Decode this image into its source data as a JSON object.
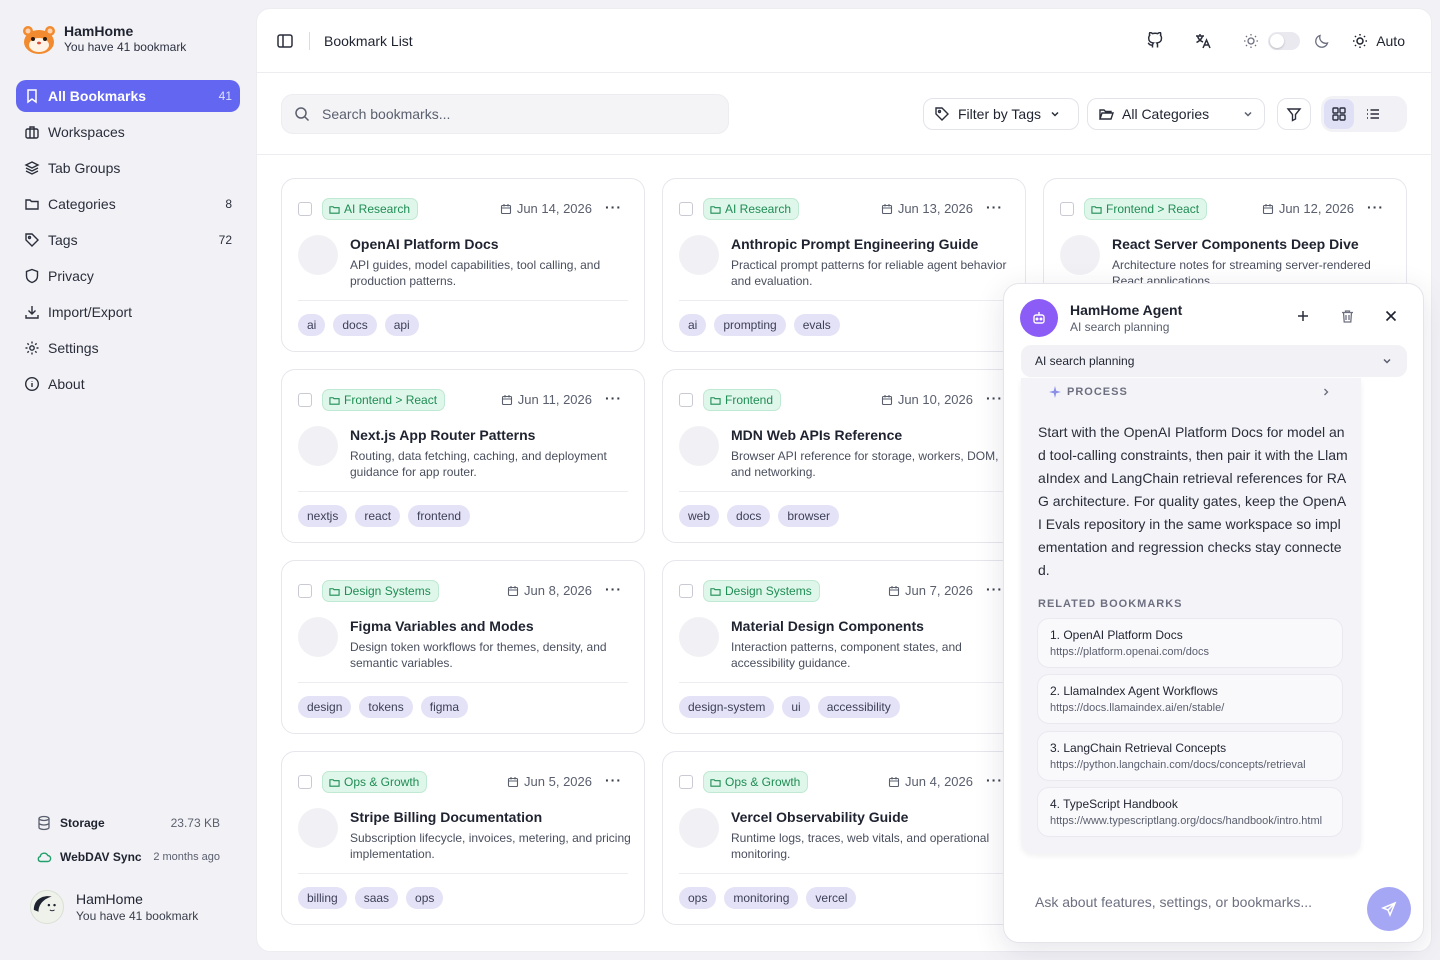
{
  "app": {
    "name": "HamHome",
    "subtitle": "You have 41 bookmark"
  },
  "sidebar": {
    "items": [
      {
        "label": "All Bookmarks",
        "count": "41",
        "icon": "bookmark-icon"
      },
      {
        "label": "Workspaces",
        "count": "",
        "icon": "briefcase-icon"
      },
      {
        "label": "Tab Groups",
        "count": "",
        "icon": "layers-icon"
      },
      {
        "label": "Categories",
        "count": "8",
        "icon": "folder-icon"
      },
      {
        "label": "Tags",
        "count": "72",
        "icon": "tag-icon"
      },
      {
        "label": "Privacy",
        "count": "",
        "icon": "shield-icon"
      },
      {
        "label": "Import/Export",
        "count": "",
        "icon": "download-icon"
      },
      {
        "label": "Settings",
        "count": "",
        "icon": "gear-icon"
      },
      {
        "label": "About",
        "count": "",
        "icon": "info-icon"
      }
    ],
    "storage": {
      "label": "Storage",
      "value": "23.73 KB"
    },
    "webdav": {
      "label": "WebDAV Sync",
      "value": "2 months ago"
    },
    "user": {
      "name": "HamHome",
      "subtitle": "You have 41 bookmark"
    }
  },
  "topbar": {
    "title": "Bookmark List",
    "theme_mode": "Auto"
  },
  "filters": {
    "search_placeholder": "Search bookmarks...",
    "tags_label": "Filter by Tags",
    "categories_label": "All Categories"
  },
  "cards": [
    {
      "category": "AI Research",
      "date": "Jun 14, 2026",
      "title": "OpenAI Platform Docs",
      "desc": "API guides, model capabilities, tool calling, and production patterns.",
      "tags": [
        "ai",
        "docs",
        "api"
      ]
    },
    {
      "category": "AI Research",
      "date": "Jun 13, 2026",
      "title": "Anthropic Prompt Engineering Guide",
      "desc": "Practical prompt patterns for reliable agent behavior and evaluation.",
      "tags": [
        "ai",
        "prompting",
        "evals"
      ]
    },
    {
      "category": "Frontend > React",
      "date": "Jun 12, 2026",
      "title": "React Server Components Deep Dive",
      "desc": "Architecture notes for streaming server-rendered React applications.",
      "tags": []
    },
    {
      "category": "Frontend > React",
      "date": "Jun 11, 2026",
      "title": "Next.js App Router Patterns",
      "desc": "Routing, data fetching, caching, and deployment guidance for app router.",
      "tags": [
        "nextjs",
        "react",
        "frontend"
      ]
    },
    {
      "category": "Frontend",
      "date": "Jun 10, 2026",
      "title": "MDN Web APIs Reference",
      "desc": "Browser API reference for storage, workers, DOM, and networking.",
      "tags": [
        "web",
        "docs",
        "browser"
      ]
    },
    {
      "category": "Design Systems",
      "date": "Jun 8, 2026",
      "title": "Figma Variables and Modes",
      "desc": "Design token workflows for themes, density, and semantic variables.",
      "tags": [
        "design",
        "tokens",
        "figma"
      ]
    },
    {
      "category": "Design Systems",
      "date": "Jun 7, 2026",
      "title": "Material Design Components",
      "desc": "Interaction patterns, component states, and accessibility guidance.",
      "tags": [
        "design-system",
        "ui",
        "accessibility"
      ]
    },
    {
      "category": "Ops & Growth",
      "date": "Jun 5, 2026",
      "title": "Stripe Billing Documentation",
      "desc": "Subscription lifecycle, invoices, metering, and pricing implementation.",
      "tags": [
        "billing",
        "saas",
        "ops"
      ]
    },
    {
      "category": "Ops & Growth",
      "date": "Jun 4, 2026",
      "title": "Vercel Observability Guide",
      "desc": "Runtime logs, traces, web vitals, and operational monitoring.",
      "tags": [
        "ops",
        "monitoring",
        "vercel"
      ]
    }
  ],
  "agent": {
    "name": "HamHome Agent",
    "subtitle": "AI search planning",
    "session": "AI search planning",
    "process_label": "PROCESS",
    "message": "Start with the OpenAI Platform Docs for model and tool-calling constraints, then pair it with the LlamaIndex and LangChain retrieval references for RAG architecture. For quality gates, keep the OpenAI Evals repository in the same workspace so implementation and regression checks stay connected.",
    "related_label": "RELATED BOOKMARKS",
    "related": [
      {
        "title": "1. OpenAI Platform Docs",
        "url": "https://platform.openai.com/docs"
      },
      {
        "title": "2. LlamaIndex Agent Workflows",
        "url": "https://docs.llamaindex.ai/en/stable/"
      },
      {
        "title": "3. LangChain Retrieval Concepts",
        "url": "https://python.langchain.com/docs/concepts/retrieval"
      },
      {
        "title": "4. TypeScript Handbook",
        "url": "https://www.typescriptlang.org/docs/handbook/intro.html"
      }
    ],
    "input_placeholder": "Ask about features, settings, or bookmarks..."
  },
  "colors": {
    "accent": "#6366f1",
    "category_green": "#1f8d54",
    "agent_purple": "#8b5cf6"
  }
}
